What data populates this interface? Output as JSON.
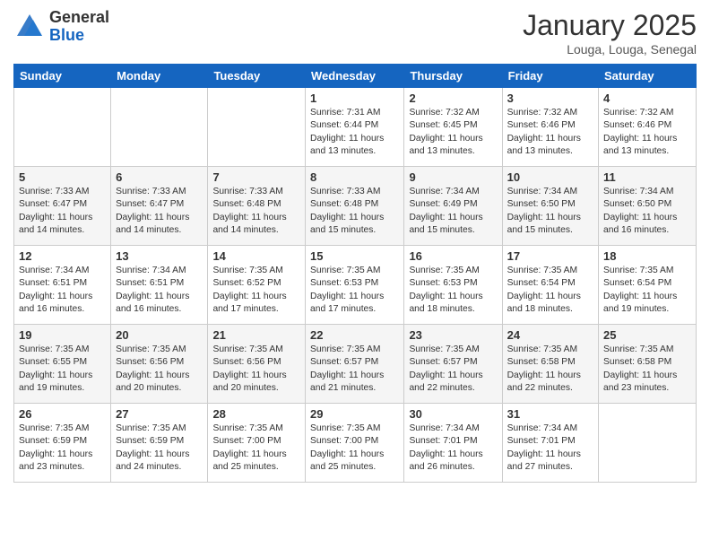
{
  "header": {
    "logo_general": "General",
    "logo_blue": "Blue",
    "month_title": "January 2025",
    "location": "Louga, Louga, Senegal"
  },
  "weekdays": [
    "Sunday",
    "Monday",
    "Tuesday",
    "Wednesday",
    "Thursday",
    "Friday",
    "Saturday"
  ],
  "weeks": [
    [
      {
        "day": "",
        "info": ""
      },
      {
        "day": "",
        "info": ""
      },
      {
        "day": "",
        "info": ""
      },
      {
        "day": "1",
        "info": "Sunrise: 7:31 AM\nSunset: 6:44 PM\nDaylight: 11 hours\nand 13 minutes."
      },
      {
        "day": "2",
        "info": "Sunrise: 7:32 AM\nSunset: 6:45 PM\nDaylight: 11 hours\nand 13 minutes."
      },
      {
        "day": "3",
        "info": "Sunrise: 7:32 AM\nSunset: 6:46 PM\nDaylight: 11 hours\nand 13 minutes."
      },
      {
        "day": "4",
        "info": "Sunrise: 7:32 AM\nSunset: 6:46 PM\nDaylight: 11 hours\nand 13 minutes."
      }
    ],
    [
      {
        "day": "5",
        "info": "Sunrise: 7:33 AM\nSunset: 6:47 PM\nDaylight: 11 hours\nand 14 minutes."
      },
      {
        "day": "6",
        "info": "Sunrise: 7:33 AM\nSunset: 6:47 PM\nDaylight: 11 hours\nand 14 minutes."
      },
      {
        "day": "7",
        "info": "Sunrise: 7:33 AM\nSunset: 6:48 PM\nDaylight: 11 hours\nand 14 minutes."
      },
      {
        "day": "8",
        "info": "Sunrise: 7:33 AM\nSunset: 6:48 PM\nDaylight: 11 hours\nand 15 minutes."
      },
      {
        "day": "9",
        "info": "Sunrise: 7:34 AM\nSunset: 6:49 PM\nDaylight: 11 hours\nand 15 minutes."
      },
      {
        "day": "10",
        "info": "Sunrise: 7:34 AM\nSunset: 6:50 PM\nDaylight: 11 hours\nand 15 minutes."
      },
      {
        "day": "11",
        "info": "Sunrise: 7:34 AM\nSunset: 6:50 PM\nDaylight: 11 hours\nand 16 minutes."
      }
    ],
    [
      {
        "day": "12",
        "info": "Sunrise: 7:34 AM\nSunset: 6:51 PM\nDaylight: 11 hours\nand 16 minutes."
      },
      {
        "day": "13",
        "info": "Sunrise: 7:34 AM\nSunset: 6:51 PM\nDaylight: 11 hours\nand 16 minutes."
      },
      {
        "day": "14",
        "info": "Sunrise: 7:35 AM\nSunset: 6:52 PM\nDaylight: 11 hours\nand 17 minutes."
      },
      {
        "day": "15",
        "info": "Sunrise: 7:35 AM\nSunset: 6:53 PM\nDaylight: 11 hours\nand 17 minutes."
      },
      {
        "day": "16",
        "info": "Sunrise: 7:35 AM\nSunset: 6:53 PM\nDaylight: 11 hours\nand 18 minutes."
      },
      {
        "day": "17",
        "info": "Sunrise: 7:35 AM\nSunset: 6:54 PM\nDaylight: 11 hours\nand 18 minutes."
      },
      {
        "day": "18",
        "info": "Sunrise: 7:35 AM\nSunset: 6:54 PM\nDaylight: 11 hours\nand 19 minutes."
      }
    ],
    [
      {
        "day": "19",
        "info": "Sunrise: 7:35 AM\nSunset: 6:55 PM\nDaylight: 11 hours\nand 19 minutes."
      },
      {
        "day": "20",
        "info": "Sunrise: 7:35 AM\nSunset: 6:56 PM\nDaylight: 11 hours\nand 20 minutes."
      },
      {
        "day": "21",
        "info": "Sunrise: 7:35 AM\nSunset: 6:56 PM\nDaylight: 11 hours\nand 20 minutes."
      },
      {
        "day": "22",
        "info": "Sunrise: 7:35 AM\nSunset: 6:57 PM\nDaylight: 11 hours\nand 21 minutes."
      },
      {
        "day": "23",
        "info": "Sunrise: 7:35 AM\nSunset: 6:57 PM\nDaylight: 11 hours\nand 22 minutes."
      },
      {
        "day": "24",
        "info": "Sunrise: 7:35 AM\nSunset: 6:58 PM\nDaylight: 11 hours\nand 22 minutes."
      },
      {
        "day": "25",
        "info": "Sunrise: 7:35 AM\nSunset: 6:58 PM\nDaylight: 11 hours\nand 23 minutes."
      }
    ],
    [
      {
        "day": "26",
        "info": "Sunrise: 7:35 AM\nSunset: 6:59 PM\nDaylight: 11 hours\nand 23 minutes."
      },
      {
        "day": "27",
        "info": "Sunrise: 7:35 AM\nSunset: 6:59 PM\nDaylight: 11 hours\nand 24 minutes."
      },
      {
        "day": "28",
        "info": "Sunrise: 7:35 AM\nSunset: 7:00 PM\nDaylight: 11 hours\nand 25 minutes."
      },
      {
        "day": "29",
        "info": "Sunrise: 7:35 AM\nSunset: 7:00 PM\nDaylight: 11 hours\nand 25 minutes."
      },
      {
        "day": "30",
        "info": "Sunrise: 7:34 AM\nSunset: 7:01 PM\nDaylight: 11 hours\nand 26 minutes."
      },
      {
        "day": "31",
        "info": "Sunrise: 7:34 AM\nSunset: 7:01 PM\nDaylight: 11 hours\nand 27 minutes."
      },
      {
        "day": "",
        "info": ""
      }
    ]
  ]
}
